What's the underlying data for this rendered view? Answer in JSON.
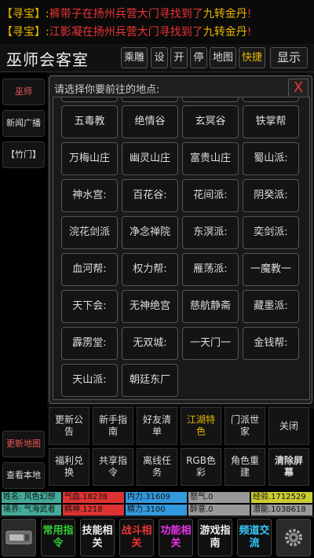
{
  "messages": {
    "partial_top": "",
    "lines": [
      {
        "tag": "【寻宝】:",
        "who": "裤带子",
        "text": "在扬州兵营大门寻找到了",
        "item": "九转金丹",
        "end": "!"
      },
      {
        "tag": "【寻宝】:",
        "who": "江影凝",
        "text": "在扬州兵营大门寻找到了",
        "item": "九转金丹",
        "end": "!"
      }
    ]
  },
  "header": {
    "title": "巫师会客室",
    "buttons": [
      "乘雕",
      "设",
      "开",
      "停",
      "地图",
      "快捷"
    ],
    "show_button": "显示"
  },
  "left": {
    "top_buttons": [
      "巫师",
      "新闻广播",
      "【竹门】"
    ],
    "bottom_buttons": [
      "更新地图",
      "查看本地"
    ]
  },
  "modal": {
    "title": "请选择你要前往的地点:",
    "close": "X",
    "locations": [
      [
        "五毒教",
        "绝情谷",
        "玄冥谷",
        "铁掌帮"
      ],
      [
        "万梅山庄",
        "幽灵山庄",
        "富贵山庄",
        "蜀山派:"
      ],
      [
        "神水宫:",
        "百花谷:",
        "花间派:",
        "阴癸派:"
      ],
      [
        "浣花剑派",
        "净念禅院",
        "东溟派:",
        "奕剑派:"
      ],
      [
        "血河帮:",
        "权力帮:",
        "雁荡派:",
        "一魔教一"
      ],
      [
        "天下会:",
        "无神绝宫",
        "慈航静斋",
        "藏墨派:"
      ],
      [
        "霹雳堂:",
        "无双城:",
        "一天门一",
        "金钱帮:"
      ],
      [
        "天山派:",
        "朝廷东厂"
      ]
    ]
  },
  "bottom_grid": [
    [
      {
        "label": "更新公告",
        "style": ""
      },
      {
        "label": "新手指南",
        "style": ""
      },
      {
        "label": "好友清单",
        "style": ""
      },
      {
        "label": "江湖特色",
        "style": "gold"
      },
      {
        "label": "门派世家",
        "style": ""
      },
      {
        "label": "关闭",
        "style": ""
      }
    ],
    [
      {
        "label": "福利兑换",
        "style": ""
      },
      {
        "label": "共享指令",
        "style": ""
      },
      {
        "label": "离线任务",
        "style": ""
      },
      {
        "label": "RGB色彩",
        "style": ""
      },
      {
        "label": "角色重建",
        "style": ""
      },
      {
        "label": "清除屏幕",
        "style": "bold"
      }
    ]
  ],
  "stats": {
    "row1": [
      {
        "label": "姓名: 风色幻想",
        "color": "#4a9"
      },
      {
        "label": "气血.18238",
        "color": "#d33"
      },
      {
        "label": "内力.31609",
        "color": "#39d"
      },
      {
        "label": "怒气.0",
        "color": "#999"
      },
      {
        "label": "经验.1712529",
        "color": "#cc3"
      }
    ],
    "row2": [
      {
        "label": "境界: 气海武者",
        "color": "#4a9"
      },
      {
        "label": "精神.1218",
        "color": "#d33"
      },
      {
        "label": "精力.3100",
        "color": "#39d"
      },
      {
        "label": "醉意.0",
        "color": "#999"
      },
      {
        "label": "潜能.1038618",
        "color": "#999"
      }
    ]
  },
  "bottombar": [
    {
      "label": "",
      "style": "icon",
      "icon": "input-icon"
    },
    {
      "label": "常用指令",
      "style": "green"
    },
    {
      "label": "技能相关",
      "style": "white"
    },
    {
      "label": "战斗相关",
      "style": "red"
    },
    {
      "label": "功能相关",
      "style": "pink"
    },
    {
      "label": "游戏指南",
      "style": "white"
    },
    {
      "label": "频道交流",
      "style": "cyan"
    },
    {
      "label": "",
      "style": "icon",
      "icon": "gear-icon"
    }
  ]
}
